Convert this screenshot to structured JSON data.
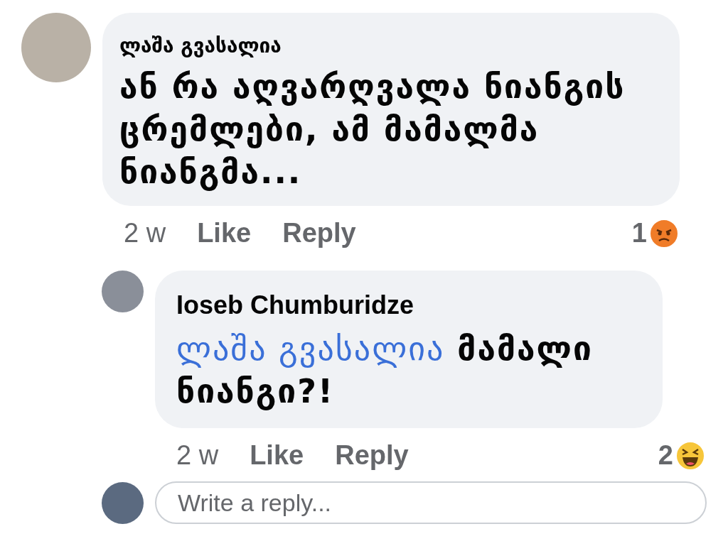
{
  "comments": [
    {
      "author": "ლაშა გვასალია",
      "text": {
        "rest": "ან რა აღვარღვალა ნიანგის ცრემლები, ამ მამალმა ნიანგმა..."
      },
      "time": "2 w",
      "like": "Like",
      "reply": "Reply",
      "reaction": {
        "count": "1",
        "kind": "angry"
      },
      "children": [
        {
          "author": "Ioseb Chumburidze",
          "text": {
            "mention": "ლაშა გვასალია",
            "rest": "მამალი ნიანგი?!"
          },
          "time": "2 w",
          "like": "Like",
          "reply": "Reply",
          "reaction": {
            "count": "2",
            "kind": "haha"
          }
        }
      ]
    }
  ],
  "reply_box": {
    "placeholder": "Write a reply..."
  }
}
